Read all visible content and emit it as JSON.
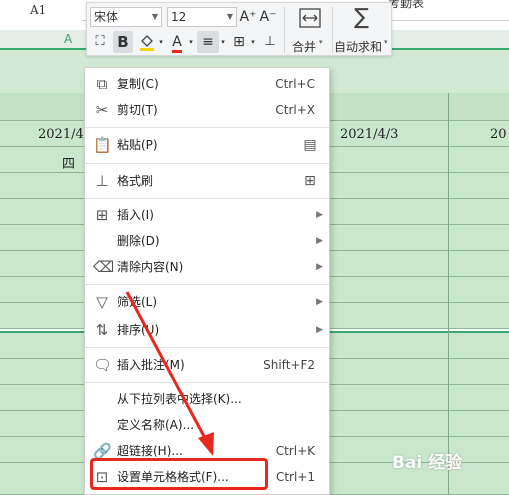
{
  "namebox": "A1",
  "partial_formula": "考勤表",
  "col_header": "A",
  "cells": {
    "date_left": "2021/4/",
    "weekday_left": "四",
    "date_mid": "2021/4/3",
    "date_right": "20"
  },
  "toolbar": {
    "font_name": "宋体",
    "font_size": "12",
    "grow_font": "A⁺",
    "shrink_font": "A⁻",
    "bold": "B",
    "merge_label": "合并",
    "autosum_label": "自动求和"
  },
  "menu": {
    "items": [
      {
        "label": "复制(C)",
        "shortcut": "Ctrl+C",
        "icon": "copy-icon"
      },
      {
        "label": "剪切(T)",
        "shortcut": "Ctrl+X",
        "icon": "scissors-icon"
      },
      {
        "label": "粘贴(P)",
        "shortcut": "",
        "icon": "paste-icon"
      },
      {
        "label": "格式刷",
        "shortcut": "",
        "icon": "format-painter-icon"
      },
      {
        "label": "插入(I)",
        "shortcut": "",
        "icon": "insert-icon"
      },
      {
        "label": "删除(D)",
        "shortcut": "",
        "icon": ""
      },
      {
        "label": "清除内容(N)",
        "shortcut": "",
        "icon": "eraser-icon"
      },
      {
        "label": "筛选(L)",
        "shortcut": "",
        "icon": "filter-icon"
      },
      {
        "label": "排序(U)",
        "shortcut": "",
        "icon": "sort-icon"
      },
      {
        "label": "插入批注(M)",
        "shortcut": "Shift+F2",
        "icon": "comment-icon"
      },
      {
        "label": "从下拉列表中选择(K)...",
        "shortcut": "",
        "icon": ""
      },
      {
        "label": "定义名称(A)...",
        "shortcut": "",
        "icon": ""
      },
      {
        "label": "超链接(H)...",
        "shortcut": "Ctrl+K",
        "icon": "link-icon"
      },
      {
        "label": "设置单元格格式(F)...",
        "shortcut": "Ctrl+1",
        "icon": "format-cells-icon"
      }
    ]
  },
  "watermark": "Bai 经验",
  "colors": {
    "highlight": "#e8281e",
    "sheet_fill": "#c9e7cd",
    "accent_green": "#38a86b"
  }
}
